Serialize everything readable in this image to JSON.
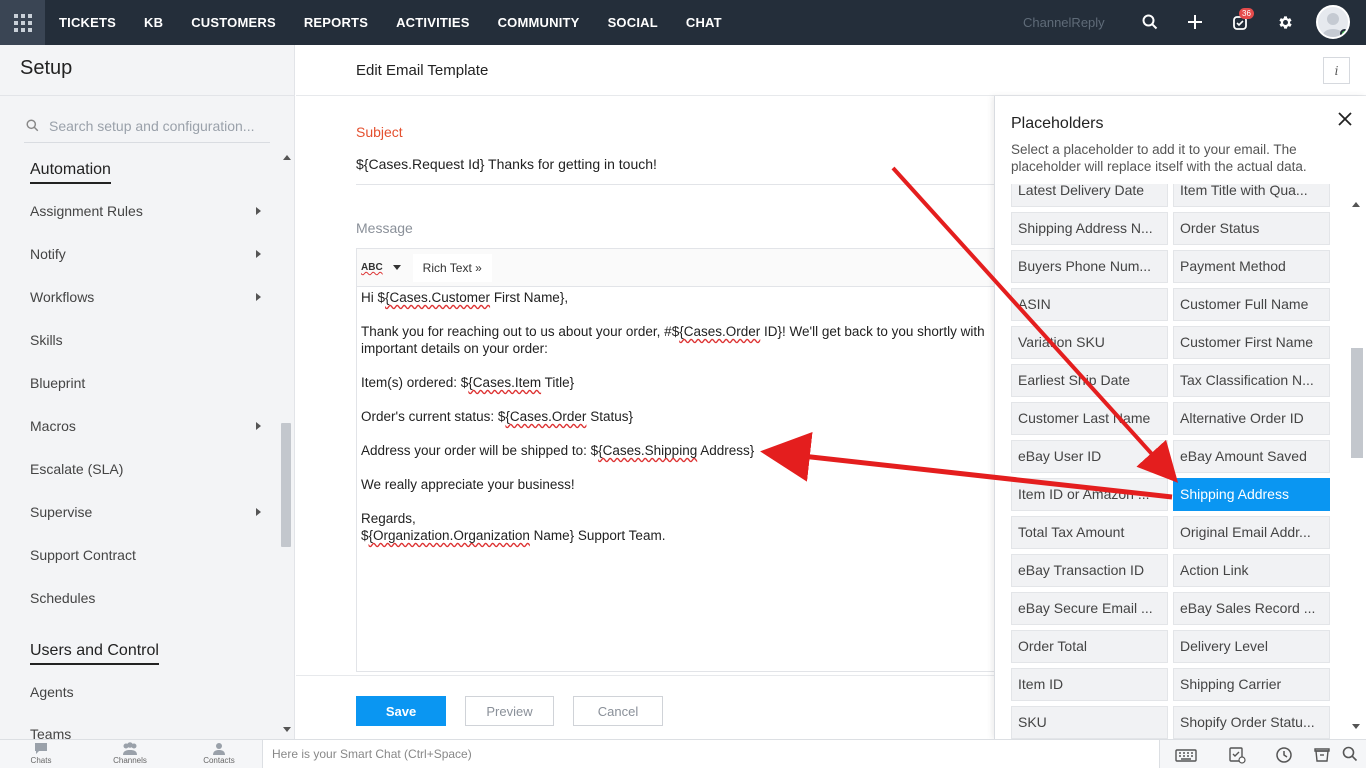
{
  "topnav": {
    "items": [
      "TICKETS",
      "KB",
      "CUSTOMERS",
      "REPORTS",
      "ACTIVITIES",
      "COMMUNITY",
      "SOCIAL",
      "CHAT"
    ],
    "brand": "ChannelReply",
    "notification_count": "36"
  },
  "sidebar": {
    "title": "Setup",
    "search_placeholder": "Search setup and configuration...",
    "sections": [
      {
        "title": "Automation",
        "items": [
          {
            "label": "Assignment Rules",
            "has_submenu": true
          },
          {
            "label": "Notify",
            "has_submenu": true
          },
          {
            "label": "Workflows",
            "has_submenu": true
          },
          {
            "label": "Skills",
            "has_submenu": false
          },
          {
            "label": "Blueprint",
            "has_submenu": false
          },
          {
            "label": "Macros",
            "has_submenu": true
          },
          {
            "label": "Escalate (SLA)",
            "has_submenu": false
          },
          {
            "label": "Supervise",
            "has_submenu": true
          },
          {
            "label": "Support Contract",
            "has_submenu": false
          },
          {
            "label": "Schedules",
            "has_submenu": false
          }
        ]
      },
      {
        "title": "Users and Control",
        "items": [
          {
            "label": "Agents",
            "has_submenu": false
          },
          {
            "label": "Teams",
            "has_submenu": false
          }
        ]
      }
    ]
  },
  "main": {
    "page_title": "Edit Email Template",
    "subject_label": "Subject",
    "subject_value": "${Cases.Request Id} Thanks for getting in touch!",
    "message_label": "Message",
    "editor_mode": "Rich Text",
    "spellcheck_label": "ABC",
    "message_lines": {
      "l1a": "Hi $",
      "l1b": "{Cases.Customer",
      "l1c": " First Name},",
      "l2a": "Thank you for reaching out to us about your order, #$",
      "l2b": "{Cases.Order",
      "l2c": " ID}! We'll get back to you shortly with",
      "l2d": "important details on your order:",
      "l3a": "Item(s) ordered: $",
      "l3b": "{Cases.Item",
      "l3c": " Title}",
      "l4a": "Order's current status: $",
      "l4b": "{Cases.Order",
      "l4c": " Status}",
      "l5a": "Address your order will be shipped to: $",
      "l5b": "{Cases.Shipping",
      "l5c": " Address}",
      "l6": "We really appreciate your business!",
      "l7": "Regards,",
      "l8a": "$",
      "l8b": "{Organization.Organization",
      "l8c": " Name} Support Team."
    },
    "buttons": {
      "save": "Save",
      "preview": "Preview",
      "cancel": "Cancel"
    }
  },
  "placeholders_panel": {
    "title": "Placeholders",
    "description": "Select a placeholder to add it to your email. The placeholder will replace itself with the actual data.",
    "selected": "Shipping Address",
    "accent_color": "#0a96f2",
    "items": [
      [
        "Latest Delivery Date",
        "Item Title with Qua..."
      ],
      [
        "Shipping Address N...",
        "Order Status"
      ],
      [
        "Buyers Phone Num...",
        "Payment Method"
      ],
      [
        "ASIN",
        "Customer Full Name"
      ],
      [
        "Variation SKU",
        "Customer First Name"
      ],
      [
        "Earliest Ship Date",
        "Tax Classification N..."
      ],
      [
        "Customer Last Name",
        "Alternative Order ID"
      ],
      [
        "eBay User ID",
        "eBay Amount Saved"
      ],
      [
        "Item ID or Amazon ...",
        "Shipping Address"
      ],
      [
        "Total Tax Amount",
        "Original Email Addr..."
      ],
      [
        "eBay Transaction ID",
        "Action Link"
      ],
      [
        "eBay Secure Email ...",
        "eBay Sales Record ..."
      ],
      [
        "Order Total",
        "Delivery Level"
      ],
      [
        "Item ID",
        "Shipping Carrier"
      ],
      [
        "SKU",
        "Shopify Order Statu..."
      ]
    ]
  },
  "bottombar": {
    "items": [
      "Chats",
      "Channels",
      "Contacts"
    ],
    "smart_chat_placeholder": "Here is your Smart Chat (Ctrl+Space)"
  },
  "annotation_color": "#e41e1e"
}
